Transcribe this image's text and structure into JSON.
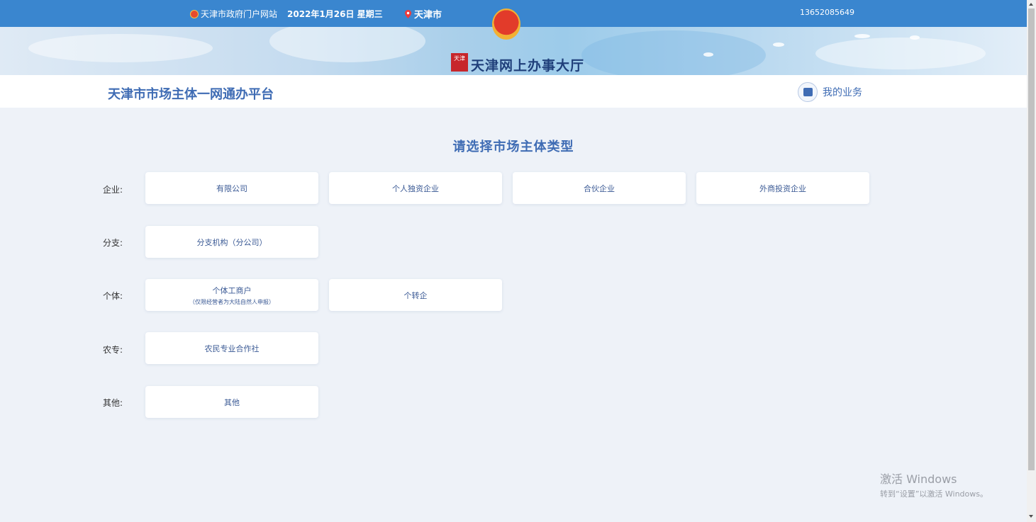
{
  "topbar": {
    "site_label": "天津市政府门户网站",
    "date": "2022年1月26日 星期三",
    "location": "天津市",
    "phone": "13652085649"
  },
  "banner": {
    "hall_title": "天津网上办事大厅",
    "seal_text": "天津"
  },
  "header": {
    "platform_title": "天津市市场主体一网通办平台",
    "my_business": "我的业务"
  },
  "main": {
    "heading": "请选择市场主体类型",
    "rows": [
      {
        "label": "企业:",
        "options": [
          "有限公司",
          "个人独资企业",
          "合伙企业",
          "外商投资企业"
        ]
      },
      {
        "label": "分支:",
        "options": [
          "分支机构（分公司）"
        ]
      },
      {
        "label": "个体:",
        "options": [
          {
            "title": "个体工商户",
            "sub": "（仅限经营者为大陆自然人申报）"
          },
          "个转企"
        ]
      },
      {
        "label": "农专:",
        "options": [
          "农民专业合作社"
        ]
      },
      {
        "label": "其他:",
        "options": [
          "其他"
        ]
      }
    ]
  },
  "watermark": {
    "line1": "激活 Windows",
    "line2": "转到“设置”以激活 Windows。"
  },
  "colors": {
    "topbar": "#3a86cf",
    "accent": "#3f6cb4",
    "page_bg": "#eef2f8"
  }
}
